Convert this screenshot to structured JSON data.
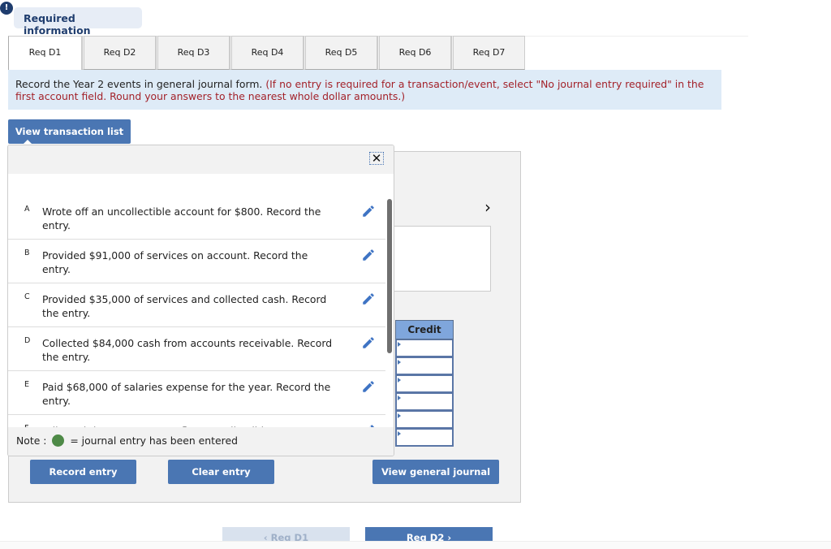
{
  "header": {
    "alert_icon": "!",
    "required_info": "Required information"
  },
  "tabs": [
    {
      "label": "Req D1",
      "active": true
    },
    {
      "label": "Req D2",
      "active": false
    },
    {
      "label": "Req D3",
      "active": false
    },
    {
      "label": "Req D4",
      "active": false
    },
    {
      "label": "Req D5",
      "active": false
    },
    {
      "label": "Req D6",
      "active": false
    },
    {
      "label": "Req D7",
      "active": false
    }
  ],
  "instruction": {
    "main": "Record the Year 2 events in general journal form. ",
    "note": "(If no entry is required for a transaction/event, select \"No journal entry required\" in the first account field. Round your answers to the nearest whole dollar amounts.)"
  },
  "view_transaction_list_label": "View transaction list",
  "popup": {
    "close_icon": "✕",
    "transactions": [
      {
        "letter": "A",
        "text": "Wrote off an uncollectible account for $800. Record the entry."
      },
      {
        "letter": "B",
        "text": "Provided $91,000 of services on account. Record the entry."
      },
      {
        "letter": "C",
        "text": "Provided $35,000 of services and collected cash. Record the entry."
      },
      {
        "letter": "D",
        "text": "Collected $84,000 cash from accounts receivable. Record the entry."
      },
      {
        "letter": "E",
        "text": "Paid $68,000 of salaries expense for the year. Record the entry."
      },
      {
        "letter": "F",
        "text": "Adjusted the accounts to reflect uncollectible accounts"
      }
    ],
    "note_prefix": "Note : ",
    "note_suffix": " = journal entry has been entered"
  },
  "journal": {
    "next_icon": "›",
    "credit_header": "Credit",
    "credit_values": [
      "",
      "",
      "",
      "",
      "",
      ""
    ]
  },
  "buttons": {
    "record_entry": "Record entry",
    "clear_entry": "Clear entry",
    "view_general_journal": "View general journal"
  },
  "nav": {
    "prev_label": "‹  Req D1",
    "next_label": "Req D2  ›"
  },
  "colors": {
    "primary_button": "#4a76b3",
    "instruction_bg": "#deebf7",
    "note_red": "#a3222a",
    "entered_dot": "#4e8a47"
  }
}
